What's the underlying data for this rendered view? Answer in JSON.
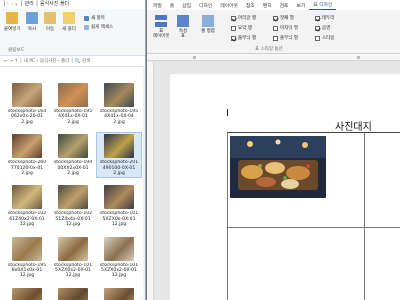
{
  "explorer": {
    "title": "│ 🗀 ⌄ │ 관리 │ 음식사진 폴더",
    "ribbon": {
      "paste_label": "붙여넣기",
      "copy_label": "복사",
      "move_label": "이동",
      "new_folder_label": "새 폴더",
      "new_item_label": "새 항목",
      "easy_access_label": "쉽게 액세스",
      "clipboard_group": "클립보드"
    },
    "address": "← → ↑ │ 내 PC › 음식사진 › 폴더 │ 🔍 검색",
    "files": [
      {
        "name": "stocksphoto-164\n062x0x-20-01\n2.jpg",
        "selected": false,
        "colors": [
          "#7a5e3e",
          "#c8a57a"
        ]
      },
      {
        "name": "stocksphoto-195\n4X41x-0X-01\n2.jpg",
        "selected": false,
        "colors": [
          "#8a6e4e",
          "#d09058"
        ]
      },
      {
        "name": "stocksphoto-195\n4X41x-0X-04\n2.jpg",
        "selected": false,
        "colors": [
          "#3c4a52",
          "#a7885a"
        ]
      },
      {
        "name": "stocksphoto-260\n770120-0x-01\n2.jpg",
        "selected": false,
        "colors": [
          "#5c3e2a",
          "#c9a06e"
        ]
      },
      {
        "name": "stocksphoto-194\n00XX2x0X-01\n2.jpg",
        "selected": false,
        "colors": [
          "#3d4a3a",
          "#b6a06e"
        ]
      },
      {
        "name": "stocksphoto-201\n490100-0X-01\n2.jpg",
        "selected": true,
        "colors": [
          "#2a3347",
          "#bda24a"
        ]
      },
      {
        "name": "stocksphoto-102\n61Z40x2-0X-01\n12.jpg",
        "selected": false,
        "colors": [
          "#6c5a40",
          "#d2b87e"
        ]
      },
      {
        "name": "stocksphoto-102\n51Z4x4x-0X-01\n12.jpg",
        "selected": false,
        "colors": [
          "#4a4a40",
          "#c0a06a"
        ]
      },
      {
        "name": "stocksphoto-101\n5XZX0x-0X-01\n12.jpg",
        "selected": false,
        "colors": [
          "#3a3e46",
          "#b08a5a"
        ]
      },
      {
        "name": "stocksphoto-195\n8x0X1x0x-01\n12.jpg",
        "selected": false,
        "colors": [
          "#c8b89a",
          "#9a7a4a"
        ]
      },
      {
        "name": "stocksphoto-101\n5XZX0x2-0X-01\n12.jpg",
        "selected": false,
        "colors": [
          "#d9c7a4",
          "#8b6a40"
        ]
      },
      {
        "name": "stocksphoto-101\n5XZX0x2-0X-01\n12.jpg",
        "selected": false,
        "colors": [
          "#d8d0c0",
          "#8a7050"
        ]
      },
      {
        "name": "",
        "selected": false,
        "colors": [
          "#b89a70",
          "#6e4e2e"
        ]
      },
      {
        "name": "",
        "selected": false,
        "colors": [
          "#b78a60",
          "#5e4a30"
        ]
      },
      {
        "name": "",
        "selected": false,
        "colors": [
          "#c9a27a",
          "#6a4e32"
        ]
      }
    ]
  },
  "word": {
    "tabs": [
      "파일",
      "홈",
      "삽입",
      "디자인",
      "레이아웃",
      "참조",
      "편지",
      "검토",
      "보기",
      "표 디자인"
    ],
    "active_tab": "표 디자인",
    "ribbon": {
      "big_buttons": [
        {
          "label": "표\n레이아웃"
        },
        {
          "label": "속성\n표"
        },
        {
          "label": "셀 병합\n"
        }
      ],
      "checks": [
        {
          "label": "머리글 행",
          "checked": true
        },
        {
          "label": "요약 행",
          "checked": false
        },
        {
          "label": "줄무늬 행",
          "checked": true
        },
        {
          "label": "첫째 열",
          "checked": true
        },
        {
          "label": "마지막 열",
          "checked": false
        },
        {
          "label": "줄무늬 열",
          "checked": false
        },
        {
          "label": "테두리",
          "checked": true
        },
        {
          "label": "음영",
          "checked": true
        },
        {
          "label": "스타일",
          "checked": false
        }
      ],
      "group_label": "표 스타일 옵션"
    },
    "document": {
      "heading": "사진대지"
    }
  }
}
